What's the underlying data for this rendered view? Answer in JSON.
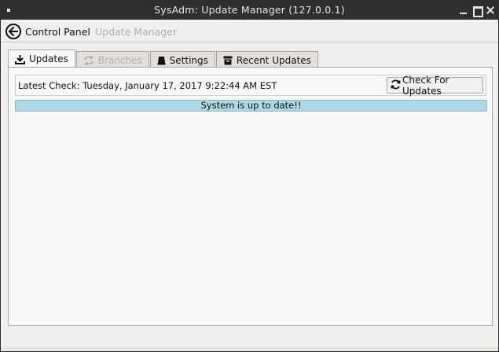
{
  "window": {
    "title": "SysAdm: Update Manager (127.0.0.1)"
  },
  "nav": {
    "back_label": "Control Panel",
    "breadcrumb": "Update Manager"
  },
  "tabs": [
    {
      "label": "Updates",
      "icon": "download-icon",
      "active": true,
      "enabled": true
    },
    {
      "label": "Branches",
      "icon": "refresh-arrows-icon",
      "active": false,
      "enabled": false
    },
    {
      "label": "Settings",
      "icon": "drive-icon",
      "active": false,
      "enabled": true
    },
    {
      "label": "Recent Updates",
      "icon": "archive-box-icon",
      "active": false,
      "enabled": true
    }
  ],
  "updates": {
    "latest_check": "Latest Check: Tuesday, January 17, 2017 9:22:44 AM EST",
    "check_button_label": "Check For Updates",
    "status_text": "System is up to date!!"
  },
  "colors": {
    "titlebar": "#2f2f2f",
    "window_bg": "#f1efed",
    "panel_bg": "#fbf9f7",
    "status_bar": "#add8e6"
  }
}
